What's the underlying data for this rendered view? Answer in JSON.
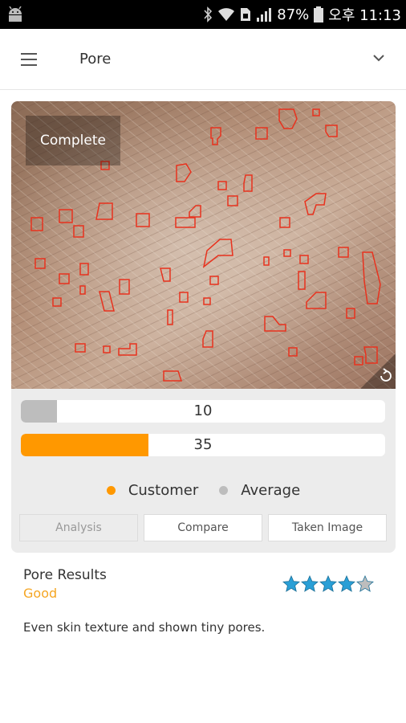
{
  "status_bar": {
    "battery": "87%",
    "time": "오후 11:13",
    "icons": [
      "android-icon",
      "bluetooth-icon",
      "wifi-icon",
      "sim-icon",
      "signal-icon",
      "battery-icon"
    ]
  },
  "toolbar": {
    "title": "Pore",
    "menu_icon": "hamburger-menu-icon",
    "dropdown_icon": "chevron-down-icon"
  },
  "analysis": {
    "overlay_label": "Complete",
    "refresh_icon": "refresh-icon",
    "average_value": "10",
    "customer_value": "35",
    "average_fill": 0.1,
    "customer_fill": 0.35,
    "legend": {
      "customer": "Customer",
      "average": "Average"
    },
    "colors": {
      "customer": "#ff9800",
      "average": "#bdbdbd",
      "pore_outline": "#e8321e"
    },
    "tabs": [
      {
        "label": "Analysis",
        "active": true
      },
      {
        "label": "Compare",
        "active": false
      },
      {
        "label": "Taken Image",
        "active": false
      }
    ]
  },
  "results": {
    "heading": "Pore Results",
    "grade": "Good",
    "rating": 4,
    "rating_max": 5,
    "description": "Even skin texture and shown tiny pores."
  }
}
